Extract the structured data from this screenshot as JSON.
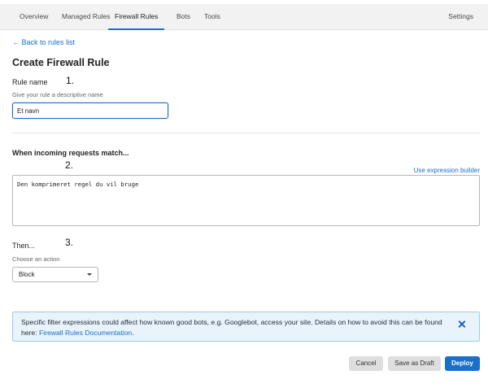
{
  "nav": {
    "tabs": [
      "Overview",
      "Managed Rules",
      "Firewall Rules",
      "Bots",
      "Tools"
    ],
    "active": "Firewall Rules",
    "settings": "Settings"
  },
  "back_link": "← Back to rules list",
  "page_title": "Create Firewall Rule",
  "steps": [
    "1.",
    "2.",
    "3."
  ],
  "rule_name": {
    "label": "Rule name",
    "hint": "Give your rule a descriptive name",
    "value": "Et navn"
  },
  "match": {
    "label": "When incoming requests match...",
    "expression_builder_link": "Use expression builder",
    "expression": "Den komprimeret regel du vil bruge"
  },
  "then": {
    "label": "Then...",
    "hint": "Choose an action",
    "selected": "Block"
  },
  "notice": {
    "text": "Specific filter expressions could affect how known good bots, e.g. Googlebot, access your site. Details on how to avoid this can be found here: ",
    "link": "Firewall Rules Documentation",
    "suffix": "."
  },
  "buttons": {
    "cancel": "Cancel",
    "save_draft": "Save as Draft",
    "deploy": "Deploy"
  },
  "colors": {
    "accent": "#1a6fc9",
    "notice_bg": "#e9f3fb",
    "notice_border": "#9ccaee"
  }
}
